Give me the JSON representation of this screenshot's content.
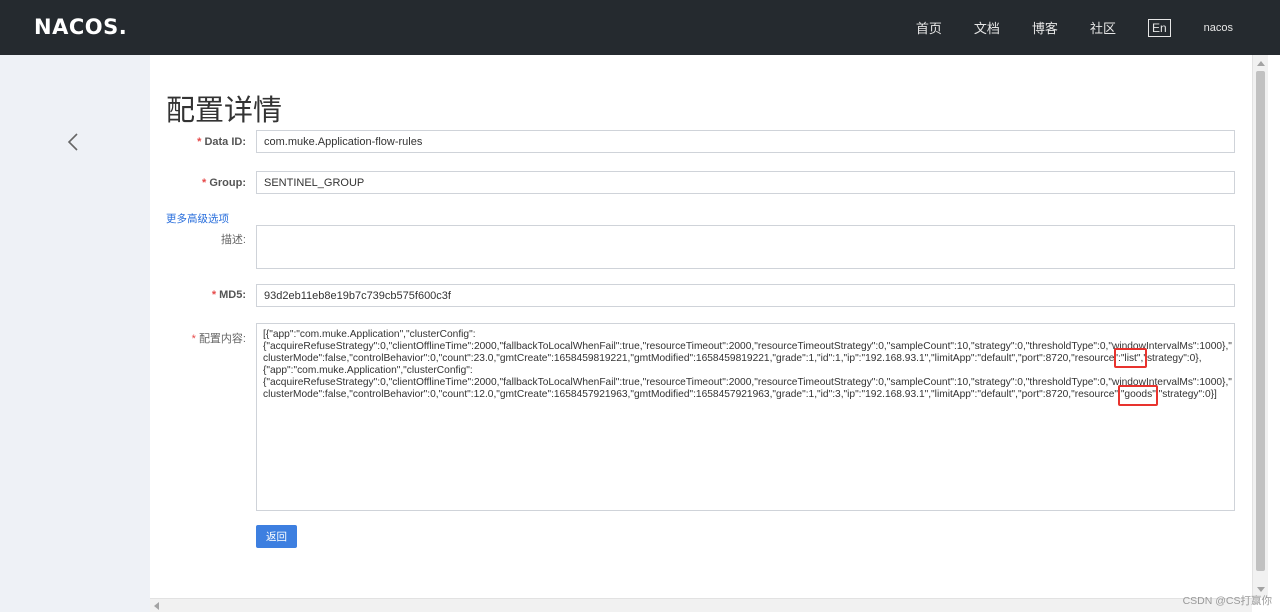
{
  "header": {
    "logo": "NACOS.",
    "nav": [
      "首页",
      "文档",
      "博客",
      "社区"
    ],
    "lang": "En",
    "user": "nacos"
  },
  "page": {
    "title": "配置详情",
    "advanced_link": "更多高级选项",
    "back_button": "返回",
    "watermark": "CSDN @CS打赢你"
  },
  "form": {
    "data_id": {
      "label": "Data ID:",
      "value": "com.muke.Application-flow-rules"
    },
    "group": {
      "label": "Group:",
      "value": "SENTINEL_GROUP"
    },
    "description": {
      "label": "描述:",
      "value": ""
    },
    "md5": {
      "label": "MD5:",
      "value": "93d2eb11eb8e19b7c739cb575f600c3f"
    },
    "content": {
      "label": "配置内容:",
      "lines": [
        "[{\"app\":\"com.muke.Application\",\"clusterConfig\":",
        "{\"acquireRefuseStrategy\":0,\"clientOfflineTime\":2000,\"fallbackToLocalWhenFail\":true,\"resourceTimeout\":2000,\"resourceTimeoutStrategy\":0,\"sampleCount\":10,\"strategy\":0,\"thresholdType\":0,\"windowIntervalMs\":1000},\"",
        "clusterMode\":false,\"controlBehavior\":0,\"count\":23.0,\"gmtCreate\":1658459819221,\"gmtModified\":1658459819221,\"grade\":1,\"id\":1,\"ip\":\"192.168.93.1\",\"limitApp\":\"default\",\"port\":8720,\"resource\":\"list\",\"strategy\":0},",
        "{\"app\":\"com.muke.Application\",\"clusterConfig\":",
        "{\"acquireRefuseStrategy\":0,\"clientOfflineTime\":2000,\"fallbackToLocalWhenFail\":true,\"resourceTimeout\":2000,\"resourceTimeoutStrategy\":0,\"sampleCount\":10,\"strategy\":0,\"thresholdType\":0,\"windowIntervalMs\":1000},\"",
        "clusterMode\":false,\"controlBehavior\":0,\"count\":12.0,\"gmtCreate\":1658457921963,\"gmtModified\":1658457921963,\"grade\":1,\"id\":3,\"ip\":\"192.168.93.1\",\"limitApp\":\"default\",\"port\":8720,\"resource\":\"goods\",\"strategy\":0}]"
      ]
    }
  },
  "colors": {
    "header_bg": "#252a2f",
    "accent": "#3d7fe0",
    "link": "#2a6fdc",
    "required": "#e64a4a",
    "highlight": "#e8332e"
  }
}
